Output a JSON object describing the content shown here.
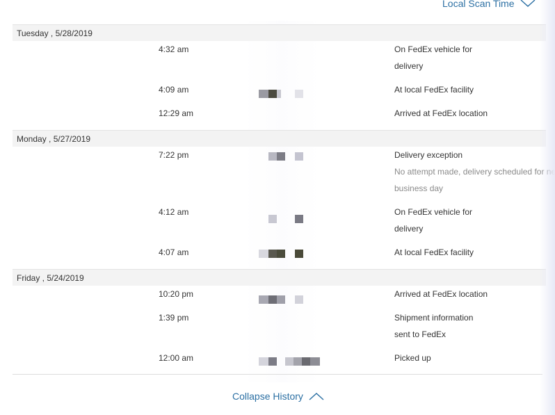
{
  "header": {
    "scan_time_label": "Local Scan Time"
  },
  "days": [
    {
      "date": "Tuesday , 5/28/2019",
      "events": [
        {
          "time": "4:32 am",
          "status_lines": [
            "On FedEx vehicle for",
            "delivery"
          ]
        },
        {
          "time": "4:09 am",
          "status_lines": [
            "At local FedEx facility"
          ]
        },
        {
          "time": "12:29 am",
          "status_lines": [
            "Arrived at FedEx location"
          ]
        }
      ]
    },
    {
      "date": "Monday , 5/27/2019",
      "events": [
        {
          "time": "7:22 pm",
          "status_lines": [
            "Delivery exception"
          ],
          "detail_lines": [
            "No attempt made, delivery scheduled for nex",
            "business day"
          ]
        },
        {
          "time": "4:12 am",
          "status_lines": [
            "On FedEx vehicle for",
            "delivery"
          ]
        },
        {
          "time": "4:07 am",
          "status_lines": [
            "At local FedEx facility"
          ]
        }
      ]
    },
    {
      "date": "Friday , 5/24/2019",
      "events": [
        {
          "time": "10:20 pm",
          "status_lines": [
            "Arrived at FedEx location"
          ]
        },
        {
          "time": "1:39 pm",
          "status_lines": [
            "Shipment information",
            "sent to FedEx"
          ]
        },
        {
          "time": "12:00 am",
          "status_lines": [
            "Picked up"
          ]
        }
      ]
    }
  ],
  "footer": {
    "collapse_label": "Collapse History"
  },
  "colors": {
    "link": "#2b6fa3",
    "header_bg": "#f3f3f3",
    "detail_text": "#8a8a8a"
  }
}
